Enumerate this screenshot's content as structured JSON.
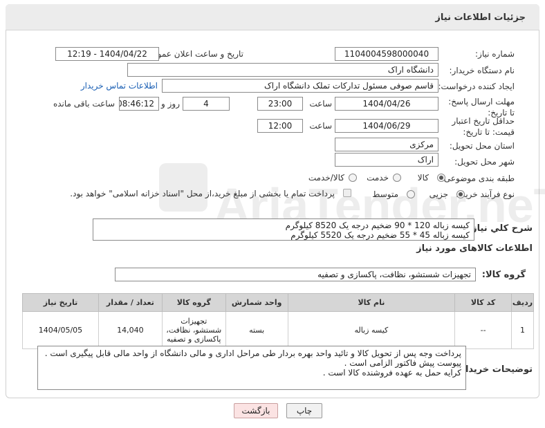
{
  "header": {
    "title": "جزئیات اطلاعات نیاز"
  },
  "fields": {
    "need_number_label": "شماره نیاز:",
    "need_number": "1104004598000040",
    "announce_label": "تاریخ و ساعت اعلان عمومی:",
    "announce_value": "1404/04/22 - 12:19",
    "buyer_org_label": "نام دستگاه خریدار:",
    "buyer_org": "دانشگاه اراک",
    "creator_label": "ایجاد کننده درخواست:",
    "creator": "قاسم صوفی مسئول تدارکات تملک دانشگاه اراک",
    "buyer_contact_link": "اطلاعات تماس خریدار",
    "reply_deadline_label": "مهلت ارسال پاسخ: تا تاریخ:",
    "reply_date": "1404/04/26",
    "time_label": "ساعت",
    "reply_time": "23:00",
    "days_value": "4",
    "days_label": "روز و",
    "remaining_time": "08:46:12",
    "remaining_label": "ساعت باقی مانده",
    "validity_label": "حداقل تاریخ اعتبار قیمت: تا تاریخ:",
    "validity_date": "1404/06/29",
    "validity_time_label": "ساعت",
    "validity_time": "12:00",
    "province_label": "استان محل تحویل:",
    "province": "مرکزی",
    "city_label": "شهر محل تحویل:",
    "city": "اراک",
    "category_label": "طبقه بندی موضوعی:",
    "category_options": [
      "کالا",
      "خدمت",
      "کالا/خدمت"
    ],
    "process_label": "نوع فرآیند خرید :",
    "process_options": [
      "جزیی",
      "متوسط"
    ],
    "treasury_note": "پرداخت تمام یا بخشی از مبلغ خرید،از محل \"اسناد خزانه اسلامی\" خواهد بود.",
    "general_desc_label": "شرح کلي نياز:",
    "general_desc": "کیسه زباله 120 * 90 ضخیم درجه یک   8520  کیلوگرم\nکیسه زباله 45 * 55  ضخیم درجه یک    5520  کیلوگرم",
    "goods_info_title": "اطلاعات کالاهای مورد نیاز",
    "goods_group_label": "گروه کالا:",
    "goods_group": "تجهیزات شستشو، نظافت، پاکسازی و تصفیه",
    "buyer_notes_label": "توضیحات خریدار:",
    "buyer_notes": "پرداخت وجه پس از تحویل کالا و تائید واحد بهره بردار طی مراحل اداری و مالی دانشگاه از واحد مالی قابل پیگیری است .\nپیوست پیش فاکتور الزامی است .\nکرایه حمل به عهده فروشنده کالا است ."
  },
  "table": {
    "headers": [
      "ردیف",
      "کد کالا",
      "نام کالا",
      "واحد شمارش",
      "گروه کالا",
      "تعداد / مقدار",
      "تاریخ نیاز"
    ],
    "rows": [
      [
        "1",
        "--",
        "کیسه زباله",
        "بسته",
        "تجهیزات شستشو، نظافت، پاکسازی و تصفیه",
        "14,040",
        "1404/05/05"
      ]
    ]
  },
  "buttons": {
    "print": "چاپ",
    "back": "بازگشت"
  },
  "watermark_text": "AriaTender.neT"
}
